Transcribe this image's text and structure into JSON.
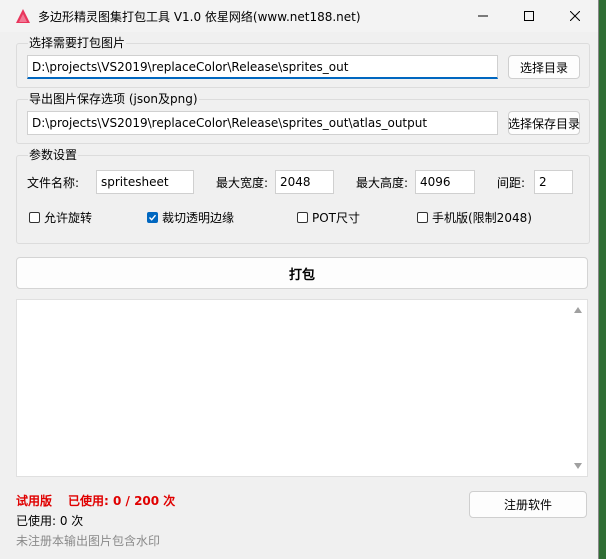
{
  "window": {
    "title": "多边形精灵图集打包工具 V1.0 依星网络(www.net188.net)",
    "accent": "#0067c0",
    "icon": "app-triangle-icon"
  },
  "input_group": {
    "label": "选择需要打包图片",
    "path": "D:\\projects\\VS2019\\replaceColor\\Release\\sprites_out",
    "button": "选择目录"
  },
  "output_group": {
    "label": "导出图片保存选项 (json及png)",
    "path": "D:\\projects\\VS2019\\replaceColor\\Release\\sprites_out\\atlas_output",
    "button": "选择保存目录"
  },
  "params": {
    "label": "参数设置",
    "filename_label": "文件名称:",
    "filename": "spritesheet",
    "max_width_label": "最大宽度:",
    "max_width": "2048",
    "max_height_label": "最大高度:",
    "max_height": "4096",
    "spacing_label": "间距:",
    "spacing": "2",
    "options": [
      {
        "label": "允许旋转",
        "checked": false
      },
      {
        "label": "裁切透明边缘",
        "checked": true
      },
      {
        "label": "POT尺寸",
        "checked": false
      },
      {
        "label": "手机版(限制2048)",
        "checked": false
      }
    ]
  },
  "pack_button": "打包",
  "status": {
    "trial": "试用版",
    "used_limit": "已使用: 0 / 200 次",
    "used": "已使用: 0 次",
    "watermark_note": "未注册本输出图片包含水印",
    "register_button": "注册软件",
    "warning_color": "#e00000"
  }
}
